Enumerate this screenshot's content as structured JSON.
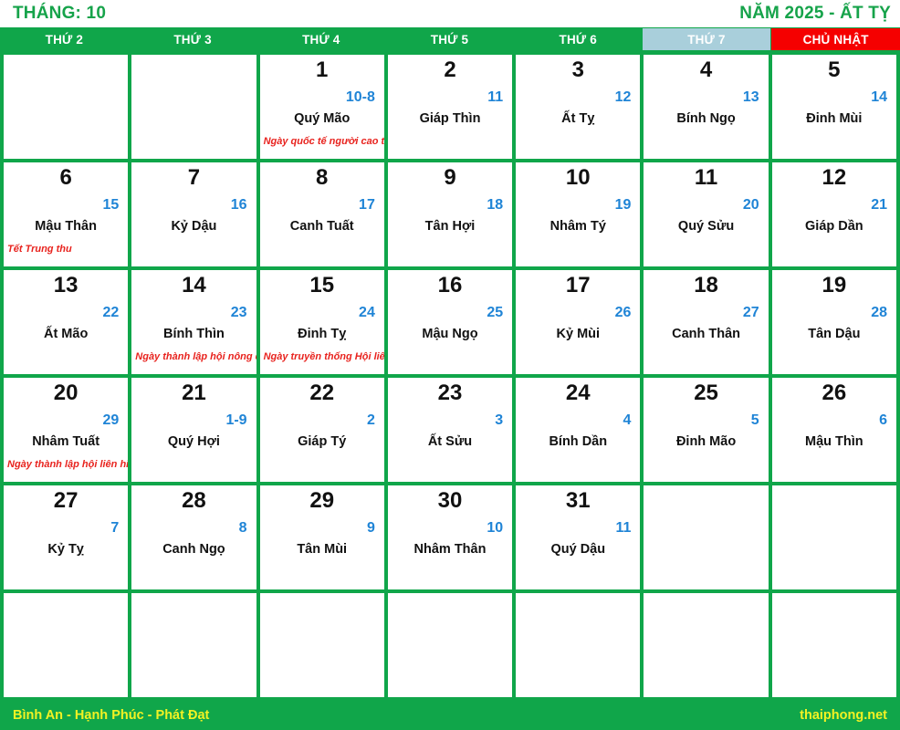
{
  "header": {
    "month_label": "THÁNG: 10",
    "year_label": "NĂM 2025 - ẤT TỴ"
  },
  "weekdays": [
    {
      "label": "THỨ 2",
      "kind": "weekday"
    },
    {
      "label": "THỨ 3",
      "kind": "weekday"
    },
    {
      "label": "THỨ 4",
      "kind": "weekday"
    },
    {
      "label": "THỨ 5",
      "kind": "weekday"
    },
    {
      "label": "THỨ 6",
      "kind": "weekday"
    },
    {
      "label": "THỨ 7",
      "kind": "saturday"
    },
    {
      "label": "CHỦ NHẬT",
      "kind": "sunday"
    }
  ],
  "colors": {
    "green": "#10a64a",
    "title_green": "#16a34a",
    "saturday_bg": "#a9cfdb",
    "sunday_bg": "#f50000",
    "lunar_blue": "#1f84d6",
    "event_red": "#e8231e",
    "footer_yellow": "#f2f223",
    "solar_black": "#111111"
  },
  "cells": [
    {
      "solar": "",
      "lunar": "",
      "canchi": "",
      "event": ""
    },
    {
      "solar": "",
      "lunar": "",
      "canchi": "",
      "event": ""
    },
    {
      "solar": "1",
      "lunar": "10-8",
      "canchi": "Quý Mão",
      "event": "Ngày quốc tế người cao tuổi"
    },
    {
      "solar": "2",
      "lunar": "11",
      "canchi": "Giáp Thìn",
      "event": ""
    },
    {
      "solar": "3",
      "lunar": "12",
      "canchi": "Ất Tỵ",
      "event": ""
    },
    {
      "solar": "4",
      "lunar": "13",
      "canchi": "Bính Ngọ",
      "event": ""
    },
    {
      "solar": "5",
      "lunar": "14",
      "canchi": "Đinh Mùi",
      "event": ""
    },
    {
      "solar": "6",
      "lunar": "15",
      "canchi": "Mậu Thân",
      "event": "Tết Trung thu"
    },
    {
      "solar": "7",
      "lunar": "16",
      "canchi": "Kỷ Dậu",
      "event": ""
    },
    {
      "solar": "8",
      "lunar": "17",
      "canchi": "Canh Tuất",
      "event": ""
    },
    {
      "solar": "9",
      "lunar": "18",
      "canchi": "Tân Hợi",
      "event": ""
    },
    {
      "solar": "10",
      "lunar": "19",
      "canchi": "Nhâm Tý",
      "event": ""
    },
    {
      "solar": "11",
      "lunar": "20",
      "canchi": "Quý Sửu",
      "event": ""
    },
    {
      "solar": "12",
      "lunar": "21",
      "canchi": "Giáp Dần",
      "event": ""
    },
    {
      "solar": "13",
      "lunar": "22",
      "canchi": "Ất Mão",
      "event": ""
    },
    {
      "solar": "14",
      "lunar": "23",
      "canchi": "Bính Thìn",
      "event": "Ngày thành lập hội nông dân"
    },
    {
      "solar": "15",
      "lunar": "24",
      "canchi": "Đinh Tỵ",
      "event": "Ngày truyền thống Hội liên hiệp"
    },
    {
      "solar": "16",
      "lunar": "25",
      "canchi": "Mậu Ngọ",
      "event": ""
    },
    {
      "solar": "17",
      "lunar": "26",
      "canchi": "Kỷ Mùi",
      "event": ""
    },
    {
      "solar": "18",
      "lunar": "27",
      "canchi": "Canh Thân",
      "event": ""
    },
    {
      "solar": "19",
      "lunar": "28",
      "canchi": "Tân Dậu",
      "event": ""
    },
    {
      "solar": "20",
      "lunar": "29",
      "canchi": "Nhâm Tuất",
      "event": "Ngày thành lập hội liên hiệp"
    },
    {
      "solar": "21",
      "lunar": "1-9",
      "canchi": "Quý Hợi",
      "event": ""
    },
    {
      "solar": "22",
      "lunar": "2",
      "canchi": "Giáp Tý",
      "event": ""
    },
    {
      "solar": "23",
      "lunar": "3",
      "canchi": "Ất Sửu",
      "event": ""
    },
    {
      "solar": "24",
      "lunar": "4",
      "canchi": "Bính Dần",
      "event": ""
    },
    {
      "solar": "25",
      "lunar": "5",
      "canchi": "Đinh Mão",
      "event": ""
    },
    {
      "solar": "26",
      "lunar": "6",
      "canchi": "Mậu Thìn",
      "event": ""
    },
    {
      "solar": "27",
      "lunar": "7",
      "canchi": "Kỷ Tỵ",
      "event": ""
    },
    {
      "solar": "28",
      "lunar": "8",
      "canchi": "Canh Ngọ",
      "event": ""
    },
    {
      "solar": "29",
      "lunar": "9",
      "canchi": "Tân Mùi",
      "event": ""
    },
    {
      "solar": "30",
      "lunar": "10",
      "canchi": "Nhâm Thân",
      "event": ""
    },
    {
      "solar": "31",
      "lunar": "11",
      "canchi": "Quý Dậu",
      "event": ""
    },
    {
      "solar": "",
      "lunar": "",
      "canchi": "",
      "event": ""
    },
    {
      "solar": "",
      "lunar": "",
      "canchi": "",
      "event": ""
    },
    {
      "solar": "",
      "lunar": "",
      "canchi": "",
      "event": ""
    },
    {
      "solar": "",
      "lunar": "",
      "canchi": "",
      "event": ""
    },
    {
      "solar": "",
      "lunar": "",
      "canchi": "",
      "event": ""
    },
    {
      "solar": "",
      "lunar": "",
      "canchi": "",
      "event": ""
    },
    {
      "solar": "",
      "lunar": "",
      "canchi": "",
      "event": ""
    },
    {
      "solar": "",
      "lunar": "",
      "canchi": "",
      "event": ""
    },
    {
      "solar": "",
      "lunar": "",
      "canchi": "",
      "event": ""
    }
  ],
  "footer": {
    "slogan": "Bình An - Hạnh Phúc - Phát Đạt",
    "site": "thaiphong.net"
  }
}
